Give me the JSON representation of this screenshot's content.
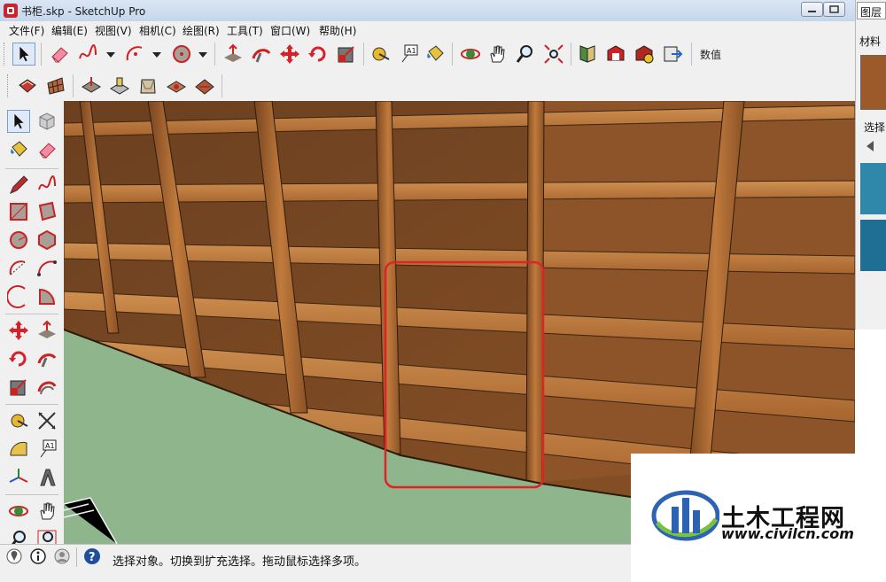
{
  "window": {
    "title": "书柜.skp - SketchUp Pro",
    "icon": "sketchup-icon",
    "controls": [
      "minimize-icon",
      "maximize-icon",
      "close-icon"
    ]
  },
  "menu": [
    "文件(F)",
    "编辑(E)",
    "视图(V)",
    "相机(C)",
    "绘图(R)",
    "工具(T)",
    "窗口(W)",
    "帮助(H)"
  ],
  "toolbar_main": {
    "tools": [
      "select-icon",
      "eraser-icon",
      "freehand-icon",
      "arc-icon",
      "circle-icon",
      "push-pull-icon",
      "follow-me-icon",
      "move-icon",
      "rotate-icon",
      "scale-icon",
      "tape-measure-icon",
      "text-icon",
      "paint-bucket-icon",
      "orbit-icon",
      "pan-icon",
      "zoom-icon",
      "zoom-extents-icon",
      "component-icon",
      "warehouse-icon",
      "extension-icon",
      "export-icon"
    ],
    "measurements_label": "数值"
  },
  "toolbar_secondary": {
    "tools": [
      "section-icon",
      "grid-icon",
      "sandbox-icon",
      "stamp-icon",
      "drape-icon",
      "add-detail-icon",
      "flip-edge-icon"
    ]
  },
  "left_toolbar": {
    "tools": [
      "select-icon",
      "component-icon",
      "paint-bucket-icon",
      "eraser-icon",
      "pencil-icon",
      "freehand-icon",
      "rectangle-icon",
      "rotated-rectangle-icon",
      "circle-icon",
      "polygon-icon",
      "arc-icon",
      "two-point-arc-icon",
      "three-point-arc-icon",
      "pie-icon",
      "move-icon",
      "push-pull-icon",
      "rotate-icon",
      "follow-me-icon",
      "scale-icon",
      "offset-icon",
      "tape-measure-icon",
      "dimension-icon",
      "protractor-icon",
      "text-icon",
      "axes-icon",
      "3d-text-icon",
      "orbit-icon",
      "pan-icon",
      "zoom-icon",
      "zoom-window-icon"
    ]
  },
  "right_panel": {
    "layers_tab": "图层",
    "materials_tab": "材料",
    "select_label": "选择",
    "swatches": [
      "#9c5a2a",
      "#2f87a9",
      "#1e6f93"
    ]
  },
  "status": {
    "icons": [
      "geo-location-icon",
      "credits-icon",
      "user-icon",
      "help-icon"
    ],
    "text": "选择对象。切换到扩充选择。拖动鼠标选择多项。"
  },
  "watermark": {
    "name": "土木工程网",
    "url": "www.civilcn.com"
  },
  "colors": {
    "wood_dark": "#3e2914",
    "wood_mid": "#8a5226",
    "wood_light": "#c88744",
    "ground": "#8fb58c",
    "highlight": "#e02424"
  }
}
